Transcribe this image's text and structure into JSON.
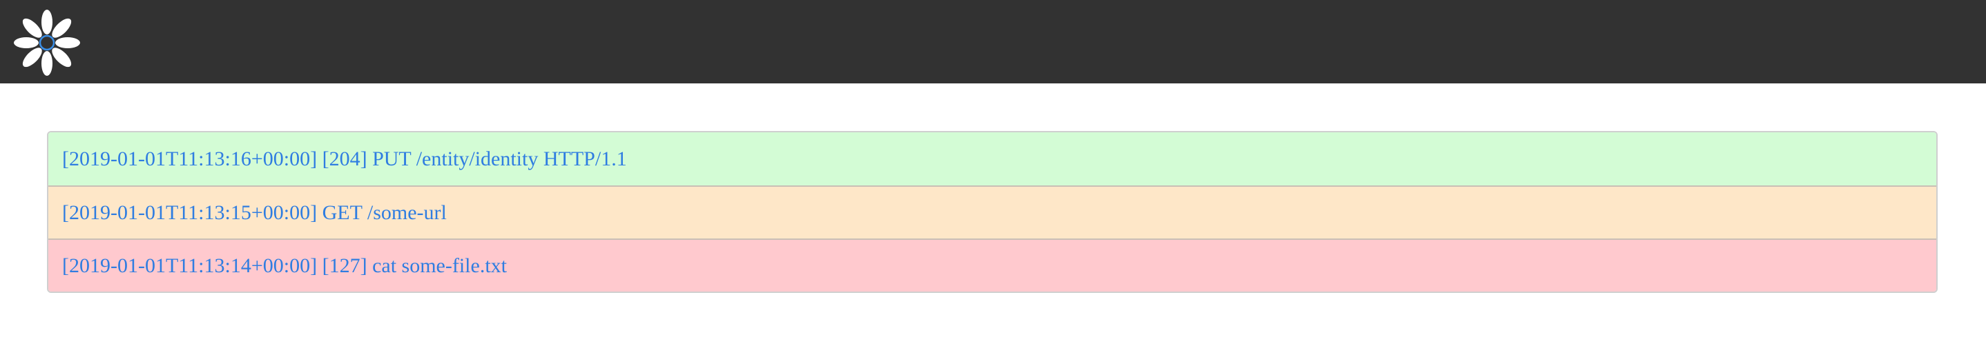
{
  "header": {
    "logo_icon": "flower-logo-icon",
    "background_color": "#323232"
  },
  "log_entries": [
    {
      "text": "[2019-01-01T11:13:16+00:00] [204] PUT /entity/identity HTTP/1.1",
      "status": "success",
      "background_color": "#d3fcd5"
    },
    {
      "text": "[2019-01-01T11:13:15+00:00] GET /some-url",
      "status": "pending",
      "background_color": "#fee7c8"
    },
    {
      "text": "[2019-01-01T11:13:14+00:00] [127] cat some-file.txt",
      "status": "error",
      "background_color": "#ffc9ce"
    }
  ],
  "colors": {
    "link_text": "#2f7de1",
    "border": "#cfcfcf"
  }
}
